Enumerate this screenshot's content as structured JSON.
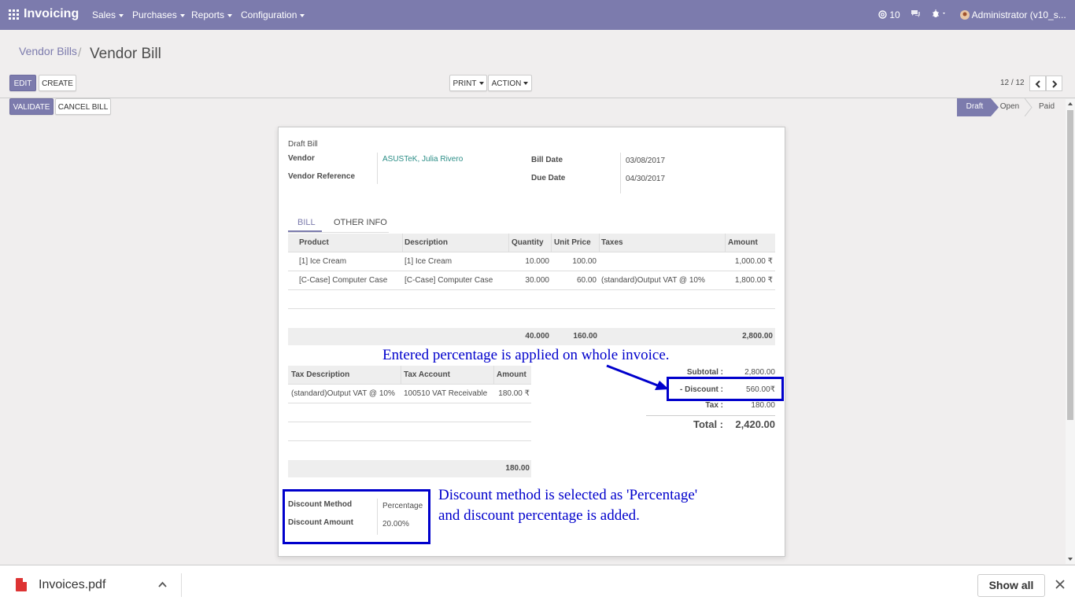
{
  "navbar": {
    "app_title": "Invoicing",
    "menus": [
      "Sales",
      "Purchases",
      "Reports",
      "Configuration"
    ],
    "message_count": "10",
    "user": "Administrator (v10_s..."
  },
  "breadcrumb": {
    "parent": "Vendor Bills",
    "current": "Vendor Bill"
  },
  "buttons": {
    "edit": "EDIT",
    "create": "CREATE",
    "print": "PRINT",
    "action": "ACTION",
    "validate": "VALIDATE",
    "cancel_bill": "CANCEL BILL"
  },
  "pager": {
    "value": "12 / 12"
  },
  "status_stages": [
    "Draft",
    "Open",
    "Paid"
  ],
  "bill": {
    "state_label": "Draft Bill",
    "vendor_label": "Vendor",
    "vendor": "ASUSTeK, Julia Rivero",
    "vendor_ref_label": "Vendor Reference",
    "bill_date_label": "Bill Date",
    "bill_date": "03/08/2017",
    "due_date_label": "Due Date",
    "due_date": "04/30/2017"
  },
  "tabs": [
    "BILL",
    "OTHER INFO"
  ],
  "lines": {
    "headers": [
      "Product",
      "Description",
      "Quantity",
      "Unit Price",
      "Taxes",
      "Amount"
    ],
    "rows": [
      [
        "[1] Ice Cream",
        "[1] Ice Cream",
        "10.000",
        "100.00",
        "",
        "1,000.00 ₹"
      ],
      [
        "[C-Case] Computer Case",
        "[C-Case] Computer Case",
        "30.000",
        "60.00",
        "(standard)Output VAT @ 10%",
        "1,800.00 ₹"
      ]
    ],
    "totals": {
      "quantity": "40.000",
      "unit_price": "160.00",
      "amount": "2,800.00"
    }
  },
  "tax_lines": {
    "headers": [
      "Tax Description",
      "Tax Account",
      "Amount"
    ],
    "rows": [
      [
        "(standard)Output VAT @ 10%",
        "100510 VAT Receivable",
        "180.00 ₹"
      ]
    ],
    "total": "180.00"
  },
  "summary": {
    "subtotal_label": "Subtotal :",
    "subtotal": "2,800.00",
    "discount_label": "- Discount :",
    "discount": "560.00₹",
    "tax_label": "Tax :",
    "tax": "180.00",
    "total_label": "Total :",
    "total": "2,420.00"
  },
  "discount": {
    "method_label": "Discount Method",
    "method": "Percentage",
    "amount_label": "Discount Amount",
    "amount": "20.00%"
  },
  "annotations": {
    "note1": "Entered percentage is applied on whole invoice.",
    "note2_line1": "Discount method is selected as 'Percentage'",
    "note2_line2": "and discount percentage is added."
  },
  "download": {
    "filename": "Invoices.pdf",
    "show_all": "Show all"
  },
  "colors": {
    "brand": "#7c7bad",
    "link": "#2a8d86",
    "annotation": "#0000cc"
  }
}
